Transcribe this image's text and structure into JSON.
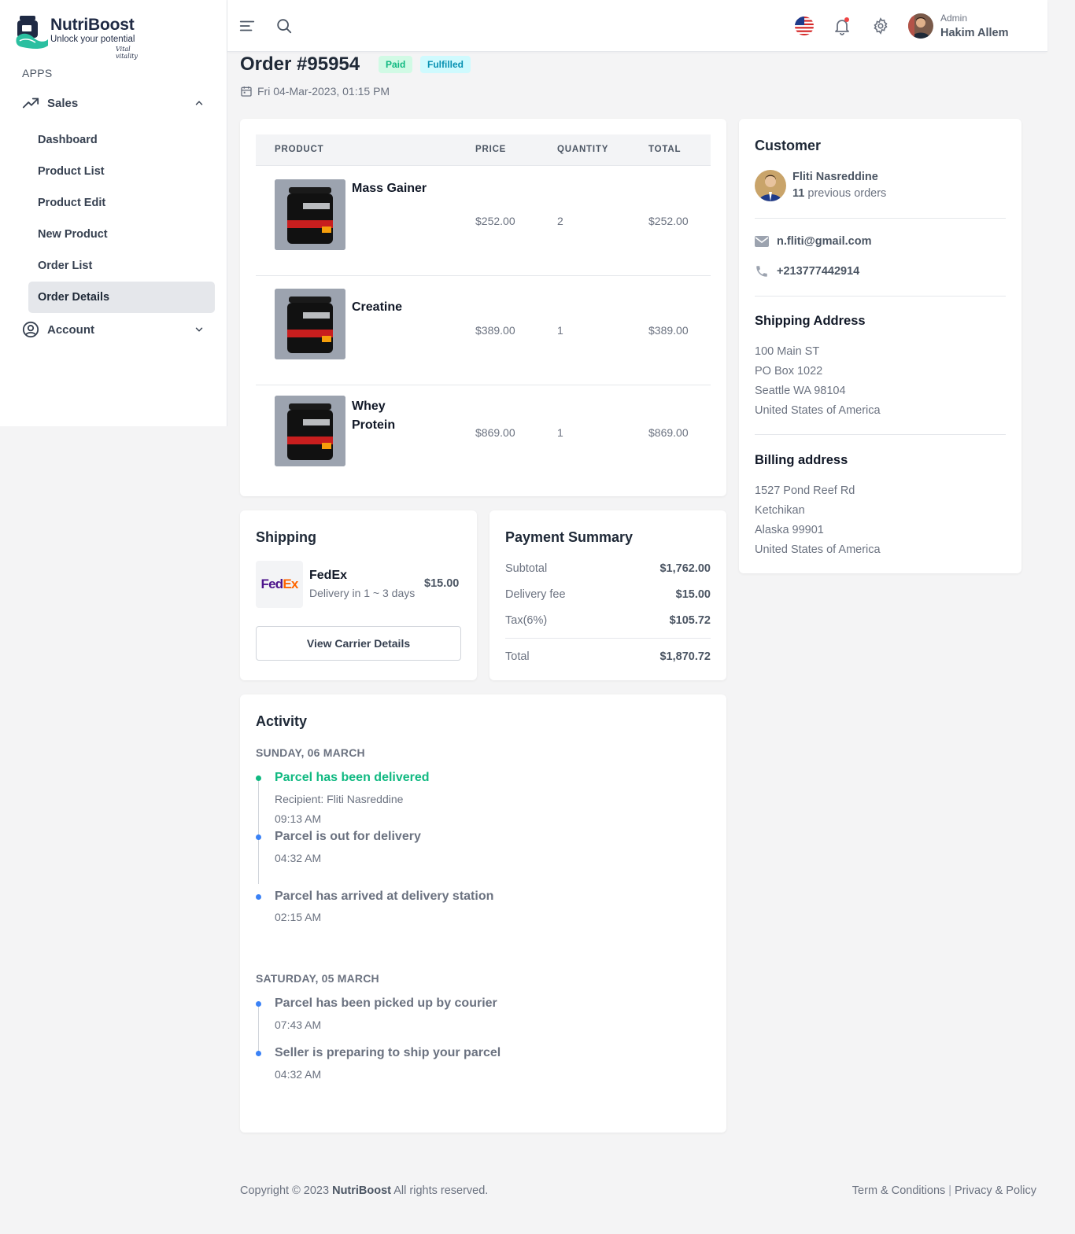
{
  "brand": {
    "name": "NutriBoost",
    "tagline": "Unlock your potential",
    "signature": "Vital vitality"
  },
  "sidebar": {
    "section_label": "APPS",
    "groups": [
      {
        "label": "Sales",
        "icon": "trending-up-icon",
        "expanded": true
      },
      {
        "label": "Account",
        "icon": "user-circle-icon",
        "expanded": false
      }
    ],
    "items": [
      {
        "label": "Dashboard"
      },
      {
        "label": "Product List"
      },
      {
        "label": "Product Edit"
      },
      {
        "label": "New Product"
      },
      {
        "label": "Order List"
      },
      {
        "label": "Order Details",
        "active": true
      }
    ]
  },
  "topbar": {
    "user_role": "Admin",
    "user_name": "Hakim Allem"
  },
  "order": {
    "title": "Order #95954",
    "badges": {
      "paid": "Paid",
      "fulfilled": "Fulfilled"
    },
    "date": "Fri 04-Mar-2023, 01:15 PM"
  },
  "products": {
    "headers": {
      "product": "PRODUCT",
      "price": "PRICE",
      "quantity": "QUANTITY",
      "total": "TOTAL"
    },
    "rows": [
      {
        "name": "Mass Gainer",
        "price": "$252.00",
        "quantity": "2",
        "total": "$252.00"
      },
      {
        "name": "Creatine",
        "price": "$389.00",
        "quantity": "1",
        "total": "$389.00"
      },
      {
        "name": "Whey Protein",
        "price": "$869.00",
        "quantity": "1",
        "total": "$869.00"
      }
    ]
  },
  "shipping": {
    "title": "Shipping",
    "carrier_logo": "FedEx",
    "carrier_name": "FedEx",
    "eta": "Delivery in 1 ~ 3 days",
    "price": "$15.00",
    "button": "View Carrier Details"
  },
  "payment": {
    "title": "Payment Summary",
    "subtotal_label": "Subtotal",
    "subtotal": "$1,762.00",
    "delivery_label": "Delivery fee",
    "delivery": "$15.00",
    "tax_label": "Tax(6%)",
    "tax": "$105.72",
    "total_label": "Total",
    "total": "$1,870.72"
  },
  "customer": {
    "title": "Customer",
    "name": "Fliti Nasreddine",
    "orders_count": "11",
    "orders_suffix": "previous orders",
    "email": "n.fliti@gmail.com",
    "phone": "+213777442914",
    "shipping_title": "Shipping Address",
    "shipping_address": [
      "100 Main ST",
      "PO Box 1022",
      "Seattle WA 98104",
      "United States of America"
    ],
    "billing_title": "Billing address",
    "billing_address": [
      "1527 Pond Reef Rd",
      "Ketchikan",
      "Alaska 99901",
      "United States of America"
    ]
  },
  "activity": {
    "title": "Activity",
    "days": [
      {
        "label": "SUNDAY, 06 MARCH",
        "events": [
          {
            "title": "Parcel has been delivered",
            "detail": "Recipient: Fliti Nasreddine",
            "time": "09:13 AM",
            "status": "delivered"
          },
          {
            "title": "Parcel is out for delivery",
            "time": "04:32 AM"
          },
          {
            "title": "Parcel has arrived at delivery station",
            "time": "02:15 AM"
          }
        ]
      },
      {
        "label": "SATURDAY, 05 MARCH",
        "events": [
          {
            "title": "Parcel has been picked up by courier",
            "time": "07:43 AM"
          },
          {
            "title": "Seller is preparing to ship your parcel",
            "time": "04:32 AM"
          }
        ]
      }
    ]
  },
  "footer": {
    "copyright_prefix": "Copyright © 2023",
    "brand": "NutriBoost",
    "copyright_suffix": "All rights reserved.",
    "terms": "Term & Conditions",
    "privacy": "Privacy & Policy"
  },
  "colors": {
    "accent_green": "#10b981",
    "accent_blue": "#3b82f6",
    "badge_cyan": "#0891b2"
  }
}
